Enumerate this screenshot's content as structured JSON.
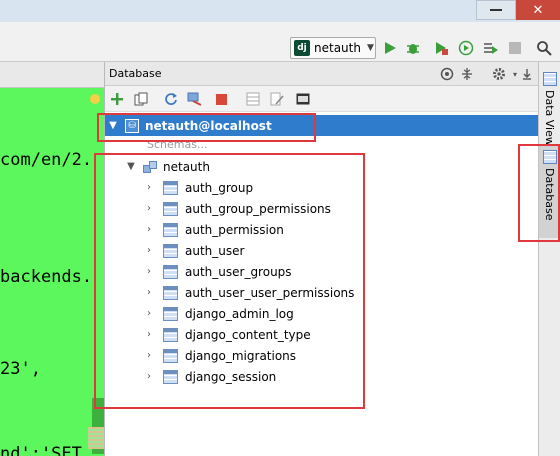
{
  "run_config": {
    "icon": "django-icon",
    "label": "netauth",
    "icon_text": "dj"
  },
  "toolbar_icons": [
    "run-icon",
    "debug-icon",
    "coverage-icon",
    "profile-icon",
    "run-tests-icon",
    "stop-icon",
    "search-icon"
  ],
  "editor": {
    "lines": [
      "com/en/2.",
      "backends.",
      "23',",
      "nd':'SET"
    ]
  },
  "db_panel": {
    "title": "Database",
    "header_icons": [
      "target-icon",
      "collapse-icon",
      "settings-icon",
      "hide-icon"
    ],
    "toolbar_icons": [
      "add-icon",
      "copy-icon",
      "refresh-icon",
      "schema-icon",
      "stop-icon",
      "table-icon",
      "edit-icon",
      "console-icon"
    ],
    "datasource": "netauth@localhost",
    "schemas_hint": "Schemas...",
    "schema": "netauth",
    "tables": [
      "auth_group",
      "auth_group_permissions",
      "auth_permission",
      "auth_user",
      "auth_user_groups",
      "auth_user_user_permissions",
      "django_admin_log",
      "django_content_type",
      "django_migrations",
      "django_session"
    ]
  },
  "right_tabs": [
    {
      "label": "Data View",
      "icon": "data-view-icon"
    },
    {
      "label": "Database",
      "icon": "database-icon"
    }
  ],
  "colors": {
    "selection": "#2f7ccc",
    "editor_bg": "#5cf75c",
    "highlight_box": "#e0393d"
  }
}
